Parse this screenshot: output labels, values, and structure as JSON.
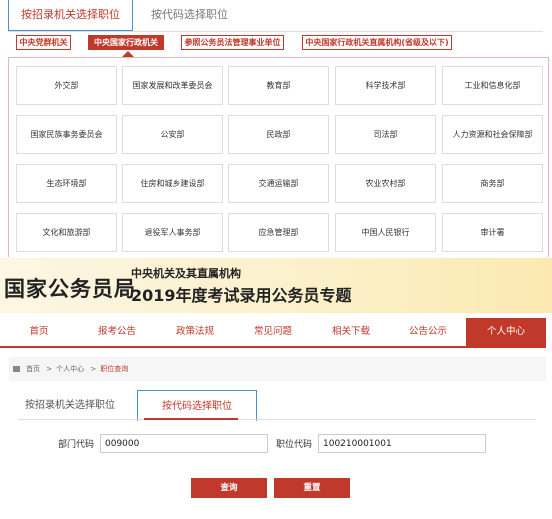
{
  "top_tabs": {
    "tab_org": "按招录机关选择职位",
    "tab_code": "按代码选择职位"
  },
  "filters": {
    "f1": "中央党群机关",
    "f2": "中央国家行政机关",
    "f3": "参照公务员法管理事业单位",
    "f4": "中央国家行政机关直属机构(省级及以下)"
  },
  "departments": [
    "外交部",
    "国家发展和改革委员会",
    "教育部",
    "科学技术部",
    "工业和信息化部",
    "国家民族事务委员会",
    "公安部",
    "民政部",
    "司法部",
    "人力资源和社会保障部",
    "生态环境部",
    "住房和城乡建设部",
    "交通运输部",
    "农业农村部",
    "商务部",
    "文化和旅游部",
    "退役军人事务部",
    "应急管理部",
    "中国人民银行",
    "审计署"
  ],
  "banner": {
    "title": "国家公务员局",
    "subtitle_1": "中央机关及其直属机构",
    "subtitle_2": "2019年度考试录用公务员专题"
  },
  "nav": [
    "首页",
    "报考公告",
    "政策法规",
    "常见问题",
    "相关下载",
    "公告公示",
    "个人中心"
  ],
  "breadcrumb": {
    "home": "首页",
    "sep": ">",
    "personal": "个人中心",
    "current": "职位查询"
  },
  "bottom_tabs": {
    "tab_org": "按招录机关选择职位",
    "tab_code": "按代码选择职位"
  },
  "form": {
    "dept_label": "部门代码",
    "dept_value": "009000",
    "pos_label": "职位代码",
    "pos_value": "100210001001",
    "query_button": "查询",
    "reset_button": "重置"
  },
  "colors": {
    "accent": "#c0392b",
    "focus_border": "#4a90d9"
  }
}
